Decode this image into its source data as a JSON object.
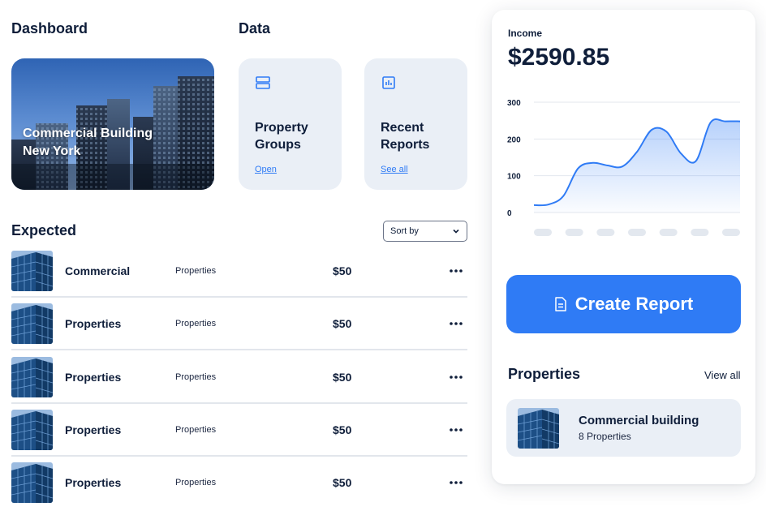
{
  "dashboard": {
    "title": "Dashboard",
    "hero": {
      "line1": "Commercial Building",
      "line2": "New York"
    }
  },
  "data_section": {
    "title": "Data",
    "cards": [
      {
        "icon": "stack-icon",
        "title_line1": "Property",
        "title_line2": "Groups",
        "link": "Open"
      },
      {
        "icon": "bar-chart-icon",
        "title_line1": "Recent",
        "title_line2": "Reports",
        "link": "See all"
      }
    ]
  },
  "expected": {
    "title": "Expected",
    "sort_label": "Sort by",
    "rows": [
      {
        "name": "Commercial",
        "category": "Properties",
        "price": "$50"
      },
      {
        "name": "Properties",
        "category": "Properties",
        "price": "$50"
      },
      {
        "name": "Properties",
        "category": "Properties",
        "price": "$50"
      },
      {
        "name": "Properties",
        "category": "Properties",
        "price": "$50"
      },
      {
        "name": "Properties",
        "category": "Properties",
        "price": "$50"
      }
    ]
  },
  "income": {
    "label": "Income",
    "value": "$2590.85"
  },
  "chart_data": {
    "type": "area",
    "y_ticks": [
      "300",
      "200",
      "100",
      "0"
    ],
    "ylim": [
      0,
      300
    ],
    "x_points": 15,
    "values": [
      20,
      22,
      45,
      120,
      135,
      128,
      125,
      165,
      225,
      220,
      160,
      140,
      245,
      248,
      248
    ],
    "x_tick_labels_hidden": 7,
    "color": "#2f7bf5"
  },
  "create_button": {
    "label": "Create Report"
  },
  "properties": {
    "title": "Properties",
    "view_all": "View all",
    "item": {
      "name": "Commercial building",
      "count": "8 Properties"
    }
  },
  "colors": {
    "accent": "#2f7bf5",
    "text": "#0f1e3a",
    "card_bg": "#eaeff6"
  }
}
